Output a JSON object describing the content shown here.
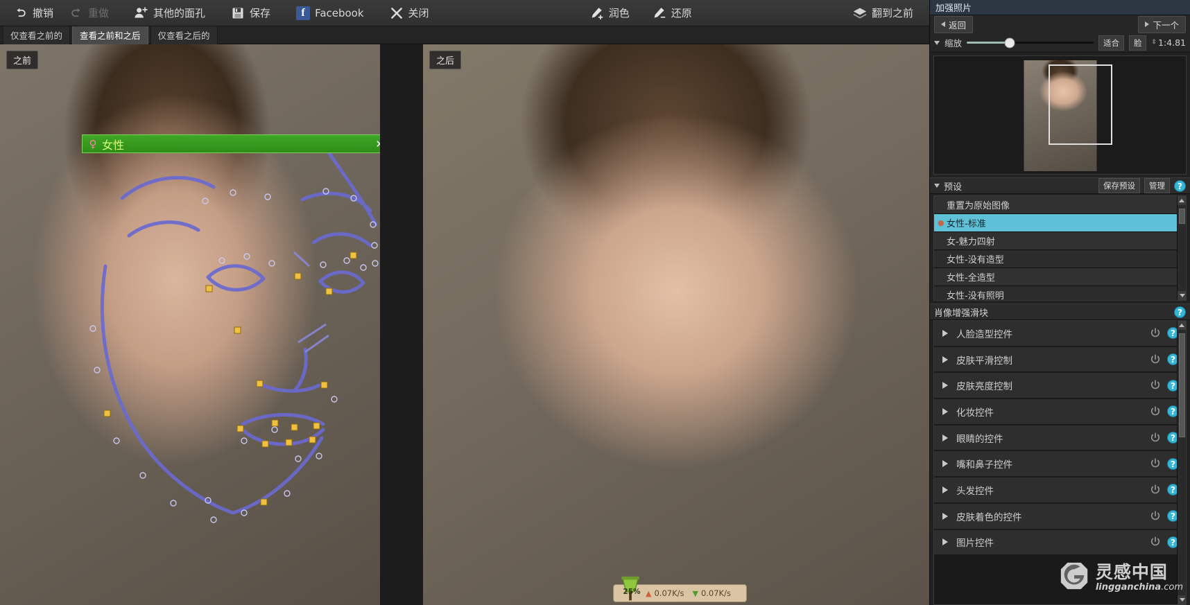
{
  "toolbar": {
    "items": [
      {
        "label": "撤销",
        "icon": "undo-icon",
        "disabled": false
      },
      {
        "label": "重做",
        "icon": "redo-icon",
        "disabled": true
      },
      {
        "label": "其他的面孔",
        "icon": "add-face-icon",
        "disabled": false
      },
      {
        "label": "保存",
        "icon": "save-disk-icon",
        "disabled": false
      },
      {
        "label": "Facebook",
        "icon": "facebook-icon",
        "disabled": false
      },
      {
        "label": "关闭",
        "icon": "close-x-icon",
        "disabled": false
      }
    ],
    "center": [
      {
        "label": "润色",
        "icon": "brush-plus-icon"
      },
      {
        "label": "还原",
        "icon": "brush-minus-icon"
      }
    ],
    "right": [
      {
        "label": "翻到之前",
        "icon": "layers-icon"
      }
    ]
  },
  "view_tabs": [
    {
      "label": "仅查看之前的",
      "active": false
    },
    {
      "label": "查看之前和之后",
      "active": true
    },
    {
      "label": "仅查看之后的",
      "active": false
    }
  ],
  "panes": {
    "before_label": "之前",
    "after_label": "之后"
  },
  "gender_banner": {
    "icon": "female-symbol-icon",
    "label": "女性",
    "close": "✕"
  },
  "download_widget": {
    "percent": "25%",
    "up_rate": "0.07K/s",
    "down_rate": "0.07K/s",
    "up_icon": "upload-arrow-icon",
    "down_icon": "download-arrow-icon"
  },
  "watermark": {
    "cn": "灵感中国",
    "en": "lingganchina",
    "suffix": ".com"
  },
  "right_panel": {
    "title": "加强照片",
    "back_button": "返回",
    "next_button": "下一个",
    "zoom_label": "缩放",
    "zoom_value": 34,
    "fit_button": "适合",
    "face_button": "脸",
    "ratio": "1:4.81",
    "presets": {
      "header": "预设",
      "save_button": "保存预设",
      "manage_button": "管理",
      "help": "?",
      "items": [
        {
          "label": "重置为原始图像",
          "selected": false,
          "pinned": false
        },
        {
          "label": "女性-标准",
          "selected": true,
          "pinned": true
        },
        {
          "label": "女-魅力四射",
          "selected": false,
          "pinned": false
        },
        {
          "label": "女性-没有造型",
          "selected": false,
          "pinned": false
        },
        {
          "label": "女性-全造型",
          "selected": false,
          "pinned": false
        },
        {
          "label": "女性-没有照明",
          "selected": false,
          "pinned": false
        }
      ]
    },
    "sliders": {
      "header": "肖像增强滑块",
      "help": "?",
      "items": [
        {
          "label": "人脸造型控件"
        },
        {
          "label": "皮肤平滑控制"
        },
        {
          "label": "皮肤亮度控制"
        },
        {
          "label": "化妆控件"
        },
        {
          "label": "眼睛的控件"
        },
        {
          "label": "嘴和鼻子控件"
        },
        {
          "label": "头发控件"
        },
        {
          "label": "皮肤着色的控件"
        },
        {
          "label": "图片控件"
        }
      ]
    }
  },
  "colors": {
    "accent_cyan": "#5fc1d8",
    "help_blue": "#35b6d6",
    "banner_green": "#3fa726",
    "title_blue": "#2d3744",
    "facebook": "#3b5998",
    "mesh": "#5b5bbf"
  }
}
